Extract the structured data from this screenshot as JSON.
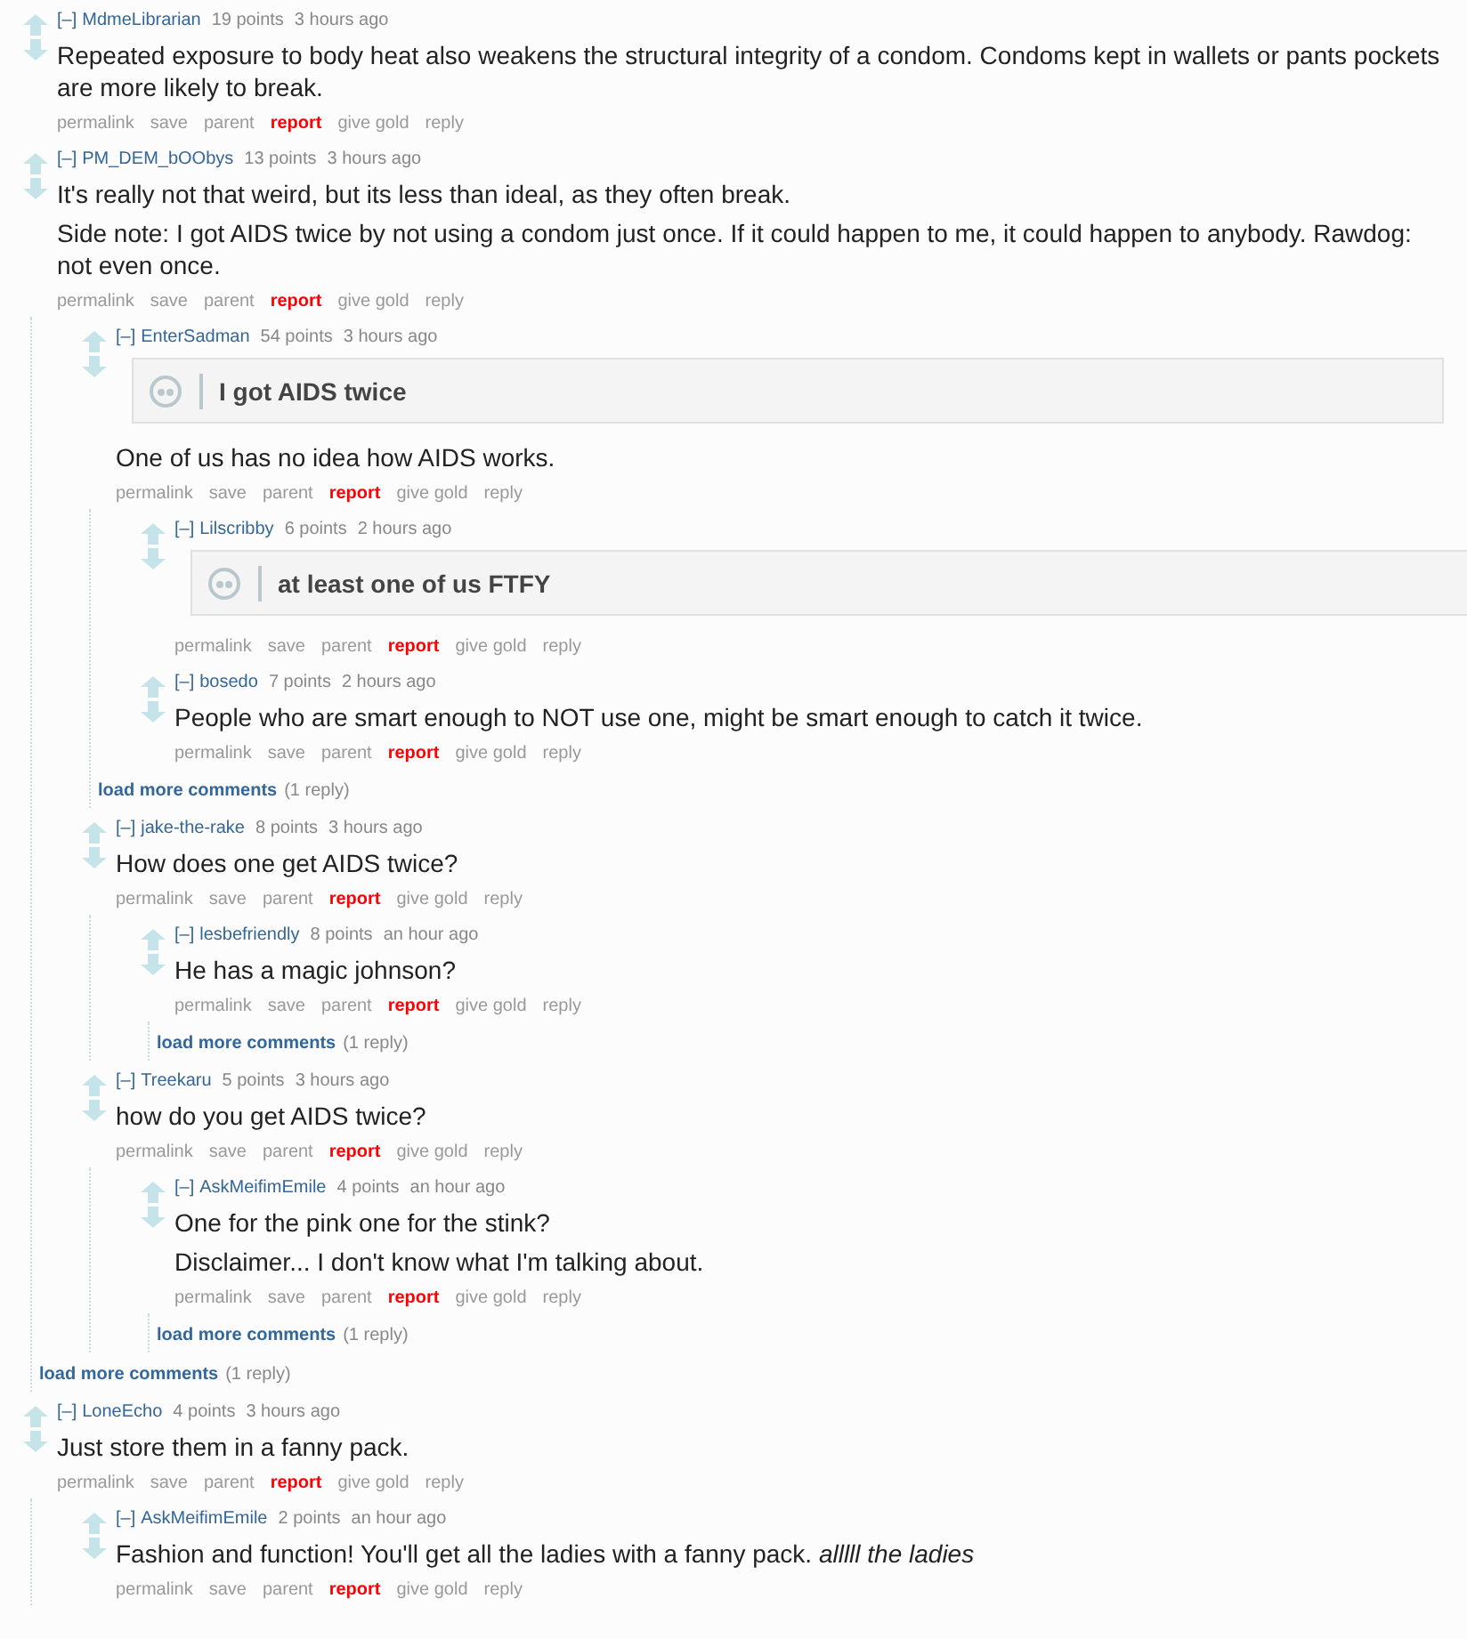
{
  "comments": [
    {
      "toggle": "[–]",
      "author": "MdmeLibrarian",
      "points": "19 points",
      "time": "3 hours ago",
      "body": [
        {
          "kind": "text",
          "text": "Repeated exposure to body heat also weakens the structural integrity of a condom. Condoms kept in wallets or pants pockets are more likely to break."
        }
      ],
      "actions": [
        {
          "label": "permalink",
          "kind": "plain"
        },
        {
          "label": "save",
          "kind": "plain"
        },
        {
          "label": "parent",
          "kind": "plain"
        },
        {
          "label": "report",
          "kind": "alert"
        },
        {
          "label": "give gold",
          "kind": "plain"
        },
        {
          "label": "reply",
          "kind": "plain"
        }
      ]
    },
    {
      "toggle": "[–]",
      "author": "PM_DEM_bOObys",
      "points": "13 points",
      "time": "3 hours ago",
      "body": [
        {
          "kind": "text",
          "text": "It's really not that weird, but its less than ideal, as they often break."
        },
        {
          "kind": "text",
          "text": "Side note: I got AIDS twice by not using a condom just once. If it could happen to me, it could happen to anybody. Rawdog: not even once."
        }
      ],
      "actions": [
        {
          "label": "permalink",
          "kind": "plain"
        },
        {
          "label": "save",
          "kind": "plain"
        },
        {
          "label": "parent",
          "kind": "plain"
        },
        {
          "label": "report",
          "kind": "alert"
        },
        {
          "label": "give gold",
          "kind": "plain"
        },
        {
          "label": "reply",
          "kind": "plain"
        }
      ],
      "children": [
        {
          "toggle": "[–]",
          "author": "EnterSadman",
          "points": "54 points",
          "time": "3 hours ago",
          "body": [
            {
              "kind": "quote",
              "text": "I got AIDS twice"
            },
            {
              "kind": "text",
              "text": "One of us has no idea how AIDS works."
            }
          ],
          "actions": [
            {
              "label": "permalink",
              "kind": "plain"
            },
            {
              "label": "save",
              "kind": "plain"
            },
            {
              "label": "parent",
              "kind": "plain"
            },
            {
              "label": "report",
              "kind": "alert"
            },
            {
              "label": "give gold",
              "kind": "plain"
            },
            {
              "label": "reply",
              "kind": "plain"
            }
          ],
          "children": [
            {
              "toggle": "[–]",
              "author": "Lilscribby",
              "points": "6 points",
              "time": "2 hours ago",
              "body": [
                {
                  "kind": "quote",
                  "text": "at least one of us FTFY"
                }
              ],
              "actions": [
                {
                  "label": "permalink",
                  "kind": "plain"
                },
                {
                  "label": "save",
                  "kind": "plain"
                },
                {
                  "label": "parent",
                  "kind": "plain"
                },
                {
                  "label": "report",
                  "kind": "alert"
                },
                {
                  "label": "give gold",
                  "kind": "plain"
                },
                {
                  "label": "reply",
                  "kind": "plain"
                }
              ]
            },
            {
              "toggle": "[–]",
              "author": "bosedo",
              "points": "7 points",
              "time": "2 hours ago",
              "body": [
                {
                  "kind": "text",
                  "text": "People who are smart enough to NOT use one, might be smart enough to catch it twice."
                }
              ],
              "actions": [
                {
                  "label": "permalink",
                  "kind": "plain"
                },
                {
                  "label": "save",
                  "kind": "plain"
                },
                {
                  "label": "parent",
                  "kind": "plain"
                },
                {
                  "label": "report",
                  "kind": "alert"
                },
                {
                  "label": "give gold",
                  "kind": "plain"
                },
                {
                  "label": "reply",
                  "kind": "plain"
                }
              ]
            }
          ],
          "more": {
            "label": "load more comments",
            "count": "(1 reply)"
          }
        },
        {
          "toggle": "[–]",
          "author": "jake-the-rake",
          "points": "8 points",
          "time": "3 hours ago",
          "body": [
            {
              "kind": "text",
              "text": "How does one get AIDS twice?"
            }
          ],
          "actions": [
            {
              "label": "permalink",
              "kind": "plain"
            },
            {
              "label": "save",
              "kind": "plain"
            },
            {
              "label": "parent",
              "kind": "plain"
            },
            {
              "label": "report",
              "kind": "alert"
            },
            {
              "label": "give gold",
              "kind": "plain"
            },
            {
              "label": "reply",
              "kind": "plain"
            }
          ],
          "children": [
            {
              "toggle": "[–]",
              "author": "lesbefriendly",
              "points": "8 points",
              "time": "an hour ago",
              "body": [
                {
                  "kind": "text",
                  "text": "He has a magic johnson?"
                }
              ],
              "actions": [
                {
                  "label": "permalink",
                  "kind": "plain"
                },
                {
                  "label": "save",
                  "kind": "plain"
                },
                {
                  "label": "parent",
                  "kind": "plain"
                },
                {
                  "label": "report",
                  "kind": "alert"
                },
                {
                  "label": "give gold",
                  "kind": "plain"
                },
                {
                  "label": "reply",
                  "kind": "plain"
                }
              ],
              "more": {
                "label": "load more comments",
                "count": "(1 reply)"
              }
            }
          ]
        },
        {
          "toggle": "[–]",
          "author": "Treekaru",
          "points": "5 points",
          "time": "3 hours ago",
          "body": [
            {
              "kind": "text",
              "text": "how do you get AIDS twice?"
            }
          ],
          "actions": [
            {
              "label": "permalink",
              "kind": "plain"
            },
            {
              "label": "save",
              "kind": "plain"
            },
            {
              "label": "parent",
              "kind": "plain"
            },
            {
              "label": "report",
              "kind": "alert"
            },
            {
              "label": "give gold",
              "kind": "plain"
            },
            {
              "label": "reply",
              "kind": "plain"
            }
          ],
          "children": [
            {
              "toggle": "[–]",
              "author": "AskMeifimEmile",
              "points": "4 points",
              "time": "an hour ago",
              "body": [
                {
                  "kind": "text",
                  "text": "One for the pink one for the stink?"
                },
                {
                  "kind": "text",
                  "text": "Disclaimer... I don't know what I'm talking about."
                }
              ],
              "actions": [
                {
                  "label": "permalink",
                  "kind": "plain"
                },
                {
                  "label": "save",
                  "kind": "plain"
                },
                {
                  "label": "parent",
                  "kind": "plain"
                },
                {
                  "label": "report",
                  "kind": "alert"
                },
                {
                  "label": "give gold",
                  "kind": "plain"
                },
                {
                  "label": "reply",
                  "kind": "plain"
                }
              ],
              "more": {
                "label": "load more comments",
                "count": "(1 reply)"
              }
            }
          ]
        }
      ],
      "more": {
        "label": "load more comments",
        "count": "(1 reply)"
      }
    },
    {
      "toggle": "[–]",
      "author": "LoneEcho",
      "points": "4 points",
      "time": "3 hours ago",
      "body": [
        {
          "kind": "text",
          "text": "Just store them in a fanny pack."
        }
      ],
      "actions": [
        {
          "label": "permalink",
          "kind": "plain"
        },
        {
          "label": "save",
          "kind": "plain"
        },
        {
          "label": "parent",
          "kind": "plain"
        },
        {
          "label": "report",
          "kind": "alert"
        },
        {
          "label": "give gold",
          "kind": "plain"
        },
        {
          "label": "reply",
          "kind": "plain"
        }
      ],
      "children": [
        {
          "toggle": "[–]",
          "author": "AskMeifimEmile",
          "points": "2 points",
          "time": "an hour ago",
          "body": [
            {
              "kind": "text",
              "text": "Fashion and function! You'll get all the ladies with a fanny pack. *alllll the ladies*"
            }
          ],
          "actions": [
            {
              "label": "permalink",
              "kind": "plain"
            },
            {
              "label": "save",
              "kind": "plain"
            },
            {
              "label": "parent",
              "kind": "plain"
            },
            {
              "label": "report",
              "kind": "alert"
            },
            {
              "label": "give gold",
              "kind": "plain"
            },
            {
              "label": "reply",
              "kind": "plain"
            }
          ]
        }
      ]
    }
  ]
}
